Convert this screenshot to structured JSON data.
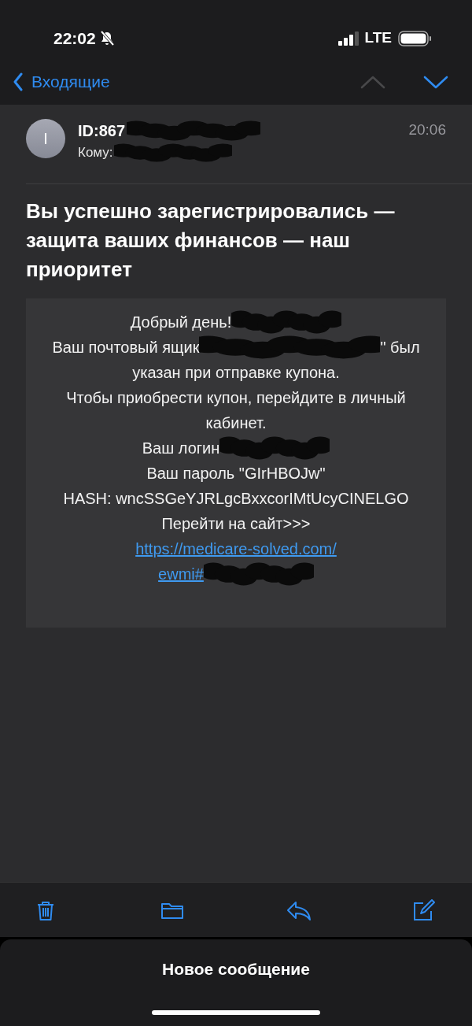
{
  "status_bar": {
    "time": "22:02",
    "network": "LTE"
  },
  "nav": {
    "back_label": "Входящие",
    "buttons": [
      {
        "kind": "up",
        "disabled": true
      },
      {
        "kind": "down",
        "disabled": false
      }
    ]
  },
  "message": {
    "avatar_letter": "I",
    "time": "20:06",
    "sender": [
      {
        "kind": "text",
        "text": "ID:867"
      },
      {
        "kind": "redaction"
      }
    ],
    "to": [
      {
        "kind": "text",
        "text": "Кому:"
      },
      {
        "kind": "redaction"
      }
    ],
    "subject": "Вы успешно зарегистрировались — защита ваших финансов — наш приоритет",
    "body_lines": [
      {
        "parts": [
          {
            "kind": "text",
            "text": "Добрый день!"
          },
          {
            "kind": "redaction"
          }
        ]
      },
      {
        "parts": [
          {
            "kind": "text",
            "text": "Ваш почтовый ящик"
          },
          {
            "kind": "redaction"
          },
          {
            "kind": "text",
            "text": "\" был"
          }
        ]
      },
      {
        "parts": [
          {
            "kind": "text",
            "text": "указан при отправке купона."
          }
        ]
      },
      {
        "parts": [
          {
            "kind": "text",
            "text": "Чтобы приобрести купон, перейдите в личный"
          }
        ]
      },
      {
        "parts": [
          {
            "kind": "text",
            "text": "кабинет."
          }
        ]
      },
      {
        "parts": [
          {
            "kind": "text",
            "text": "Ваш логин"
          },
          {
            "kind": "redaction"
          }
        ]
      },
      {
        "parts": [
          {
            "kind": "text",
            "text": "Ваш пароль \"GIrHBOJw\""
          }
        ]
      },
      {
        "parts": [
          {
            "kind": "text",
            "text": "HASH: wncSSGeYJRLgcBxxcorIMtUcyCINELGO"
          }
        ]
      },
      {
        "parts": [
          {
            "kind": "text",
            "text": "Перейти на сайт>>>"
          }
        ]
      },
      {
        "parts": [
          {
            "kind": "link",
            "text": "https://medicare-solved.com/"
          }
        ]
      },
      {
        "parts": [
          {
            "kind": "link",
            "text": "ewmi#"
          },
          {
            "kind": "redaction"
          }
        ]
      }
    ]
  },
  "toolbar": [
    {
      "kind": "trash"
    },
    {
      "kind": "folder"
    },
    {
      "kind": "reply"
    },
    {
      "kind": "compose"
    }
  ],
  "bottom_sheet": {
    "title": "Новое сообщение"
  }
}
